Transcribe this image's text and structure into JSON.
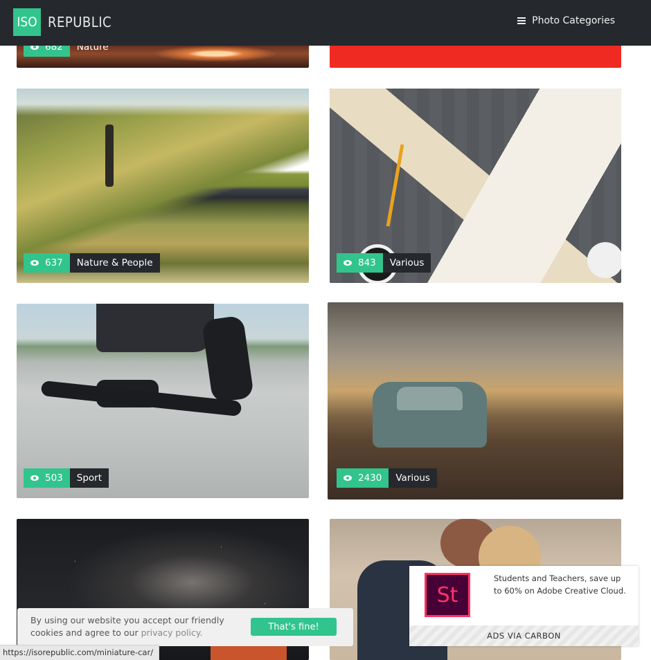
{
  "header": {
    "logo_box": "ISO",
    "logo_text": "REPUBLIC",
    "menu_label": "Photo Categories"
  },
  "cards": [
    {
      "views": "682",
      "category": "Nature",
      "image": "rocky-landscape-photo"
    },
    {
      "views": "",
      "category": "",
      "image": "red-graphic-photo"
    },
    {
      "views": "637",
      "category": "Nature & People",
      "image": "man-mountain-lake-reflection-photo"
    },
    {
      "views": "843",
      "category": "Various",
      "image": "desk-pencils-notebook-photo"
    },
    {
      "views": "503",
      "category": "Sport",
      "image": "skateboard-sneakers-photo"
    },
    {
      "views": "2430",
      "category": "Various",
      "image": "miniature-car-photo"
    },
    {
      "views": "",
      "category": "",
      "image": "milky-way-night-sky-photo"
    },
    {
      "views": "",
      "category": "",
      "image": "couple-embrace-photo"
    }
  ],
  "cookie": {
    "text": "By using our website you accept our friendly cookies and agree to our ",
    "link": "privacy policy.",
    "button": "That's fine!"
  },
  "ad": {
    "logo": "St",
    "text": "Students and Teachers, save up to 60% on Adobe Creative Cloud.",
    "footer": "ADS VIA CARBON"
  },
  "status_bar": "https://isorepublic.com/miniature-car/",
  "colors": {
    "accent": "#32c48d",
    "header": "#25282c",
    "category_bg": "#25282c"
  }
}
